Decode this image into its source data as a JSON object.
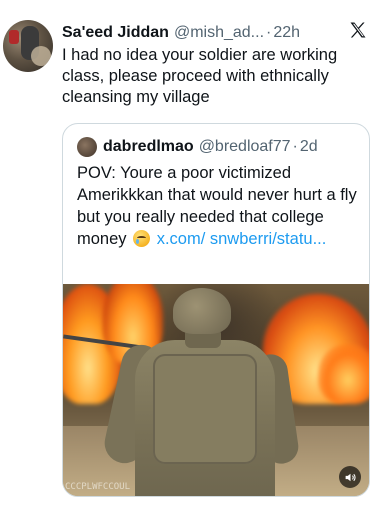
{
  "tweet": {
    "author": {
      "display_name": "Sa'eed Jiddan",
      "handle": "@mish_ad...",
      "time": "22h"
    },
    "separator": "·",
    "text": "I had no idea your soldier are working class, please proceed with ethnically cleansing my village"
  },
  "quote": {
    "author": {
      "display_name": "dabredlmao",
      "handle": "@bredloaf77",
      "time": "2d"
    },
    "separator": "·",
    "text_before_emoji": "POV: Youre a poor victimized Amerikkkan that would never hurt a fly but you really needed that college money ",
    "link_text": "x.com/ snwberri/statu...",
    "emoji": "crying-face",
    "media": {
      "type": "video",
      "watermark": "CCCPLWFCCOUL"
    }
  },
  "icons": {
    "platform_logo": "x-logo-icon",
    "mute": "volume-icon"
  },
  "colors": {
    "text": "#0f1419",
    "secondary": "#536471",
    "link": "#1d9bf0",
    "border": "#cfd9de"
  }
}
